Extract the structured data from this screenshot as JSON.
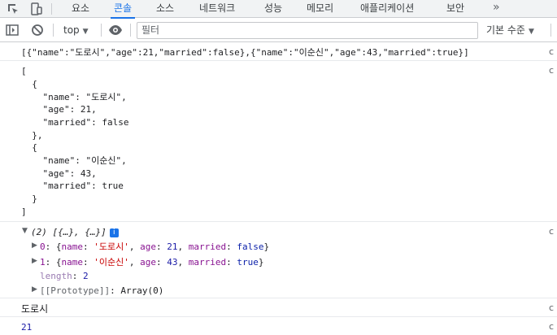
{
  "tabs": [
    {
      "label": "요소",
      "active": false
    },
    {
      "label": "콘솔",
      "active": true
    },
    {
      "label": "소스",
      "active": false
    },
    {
      "label": "네트워크",
      "active": false
    },
    {
      "label": "성능",
      "active": false
    },
    {
      "label": "메모리",
      "active": false
    },
    {
      "label": "애플리케이션",
      "active": false
    },
    {
      "label": "보안",
      "active": false
    }
  ],
  "more_tabs": "»",
  "toolbar": {
    "context": "top",
    "filter_placeholder": "필터",
    "levels": "기본 수준"
  },
  "console": {
    "json_string": "[{\"name\":\"도로시\",\"age\":21,\"married\":false},{\"name\":\"이순신\",\"age\":43,\"married\":true}]",
    "pretty_lines": [
      "[",
      "  {",
      "    \"name\": \"도로시\",",
      "    \"age\": 21,",
      "    \"married\": false",
      "  },",
      "  {",
      "    \"name\": \"이순신\",",
      "    \"age\": 43,",
      "    \"married\": true",
      "  }",
      "]"
    ],
    "array_summary": "(2) [{…}, {…}]",
    "info_badge": "i",
    "items": [
      {
        "index": "0",
        "name": "도로시",
        "age": "21",
        "married": "false"
      },
      {
        "index": "1",
        "name": "이순신",
        "age": "43",
        "married": "true"
      }
    ],
    "length_key": "length",
    "length_value": "2",
    "prototype_key": "[[Prototype]]",
    "prototype_value": "Array(0)",
    "name_output": "도로시",
    "age_output": "21"
  }
}
